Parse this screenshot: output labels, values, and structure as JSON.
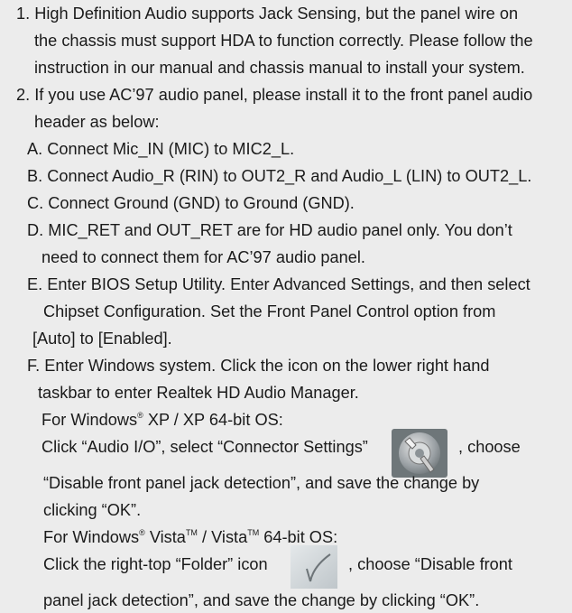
{
  "notes": {
    "item1": {
      "l1": "1. High Definition Audio supports Jack Sensing, but the panel wire on",
      "l2": "the chassis must support HDA to function correctly. Please follow the",
      "l3": "instruction in our manual and chassis manual to install your system."
    },
    "item2": {
      "l1": "2. If you use AC’97 audio panel, please install it to the front panel audio",
      "l2": "header as below:"
    },
    "a": "A. Connect Mic_IN (MIC) to MIC2_L.",
    "b": "B. Connect Audio_R (RIN) to OUT2_R and Audio_L (LIN) to OUT2_L.",
    "c": "C. Connect Ground (GND) to Ground (GND).",
    "d": {
      "l1": "D. MIC_RET and OUT_RET are for HD audio panel only. You don’t",
      "l2": "need to connect them for AC’97 audio panel."
    },
    "e": {
      "l1": "E. Enter BIOS Setup Utility. Enter Advanced Settings, and then select",
      "l2": "Chipset Configuration. Set the Front Panel Control option from",
      "l3": "[Auto] to [Enabled]."
    },
    "f": {
      "l1": "F. Enter Windows system. Click the icon on the lower right hand",
      "l2": "taskbar to enter Realtek HD Audio Manager.",
      "xp_heading_pre": "For Windows",
      "xp_heading_sup": "®",
      "xp_heading_post": " XP / XP 64-bit OS:",
      "xp_l1_pre": "Click “Audio I/O”, select “Connector Settings”",
      "xp_l1_post": ", choose",
      "xp_l2": "“Disable front panel jack detection”, and save the change by",
      "xp_l3": "clicking “OK”.",
      "vista_heading_pre": "For Windows",
      "vista_heading_sup1": "®",
      "vista_heading_mid1": " Vista",
      "vista_heading_sup2": "TM",
      "vista_heading_mid2": " / Vista",
      "vista_heading_sup3": "TM",
      "vista_heading_post": " 64-bit OS:",
      "vista_l1_pre": "Click the right-top “Folder” icon",
      "vista_l1_post": ", choose “Disable front",
      "vista_l2": "panel jack detection”, and save the change by clicking “OK”."
    }
  },
  "icons": {
    "connector_settings": "wrench-gear-icon",
    "folder": "folder-icon"
  }
}
